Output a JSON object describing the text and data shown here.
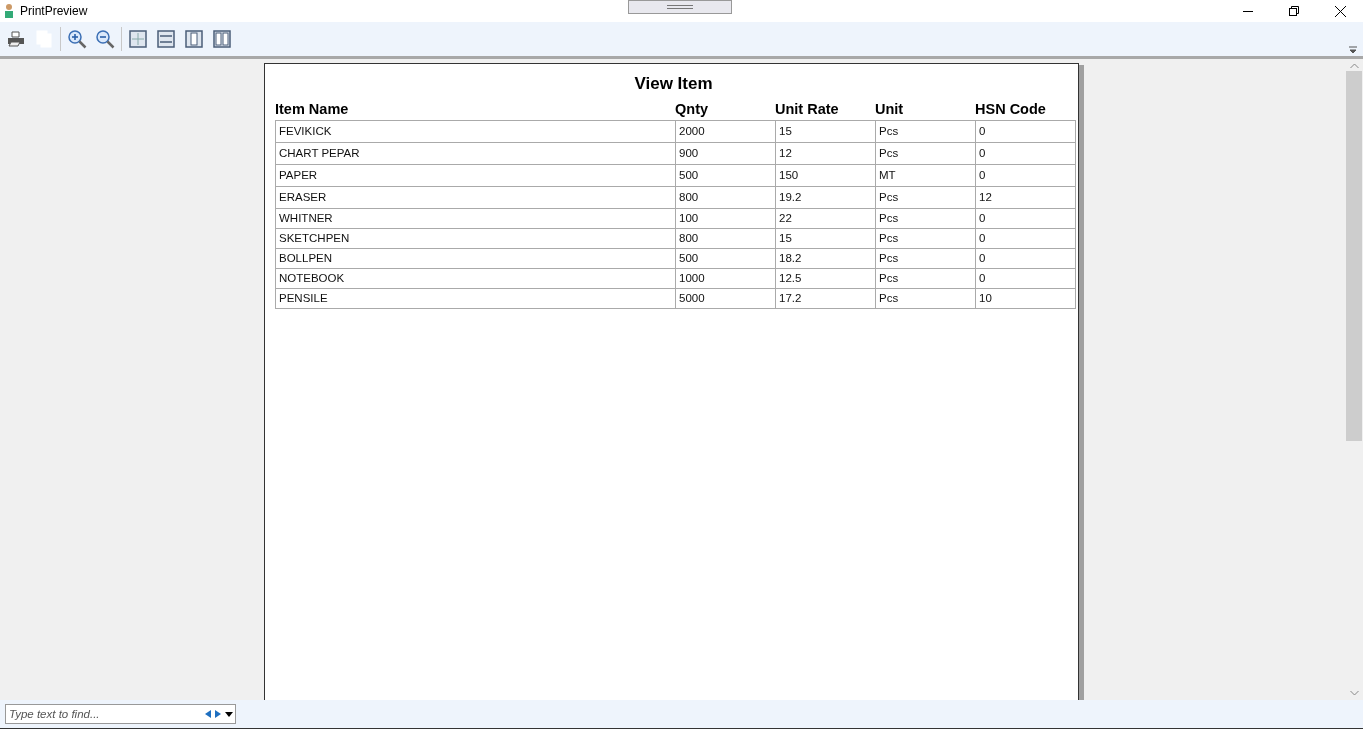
{
  "window": {
    "title": "PrintPreview"
  },
  "toolbar": [
    {
      "kind": "print",
      "disabled": false
    },
    {
      "kind": "copy",
      "disabled": true
    },
    {
      "kind": "separator"
    },
    {
      "kind": "zoom-in",
      "disabled": false
    },
    {
      "kind": "zoom-out",
      "disabled": false
    },
    {
      "kind": "separator"
    },
    {
      "kind": "fit-page",
      "disabled": false
    },
    {
      "kind": "fit-width",
      "disabled": false
    },
    {
      "kind": "one-page",
      "disabled": false
    },
    {
      "kind": "two-pages",
      "disabled": false
    }
  ],
  "report": {
    "title": "View Item",
    "columns": [
      "Item Name",
      "Qnty",
      "Unit Rate",
      "Unit",
      "HSN Code"
    ],
    "rows": [
      [
        "FEVIKICK",
        "2000",
        "15",
        "Pcs",
        "0"
      ],
      [
        "CHART PEPAR",
        "900",
        "12",
        "Pcs",
        "0"
      ],
      [
        "PAPER",
        "500",
        "150",
        "MT",
        "0"
      ],
      [
        "ERASER",
        "800",
        "19.2",
        "Pcs",
        "12"
      ],
      [
        "WHITNER",
        "100",
        "22",
        "Pcs",
        "0"
      ],
      [
        "SKETCHPEN",
        "800",
        "15",
        "Pcs",
        "0"
      ],
      [
        "BOLLPEN",
        "500",
        "18.2",
        "Pcs",
        "0"
      ],
      [
        "NOTEBOOK",
        "1000",
        "12.5",
        "Pcs",
        "0"
      ],
      [
        "PENSILE",
        "5000",
        "17.2",
        "Pcs",
        "10"
      ]
    ]
  },
  "find": {
    "placeholder": "Type text to find..."
  }
}
